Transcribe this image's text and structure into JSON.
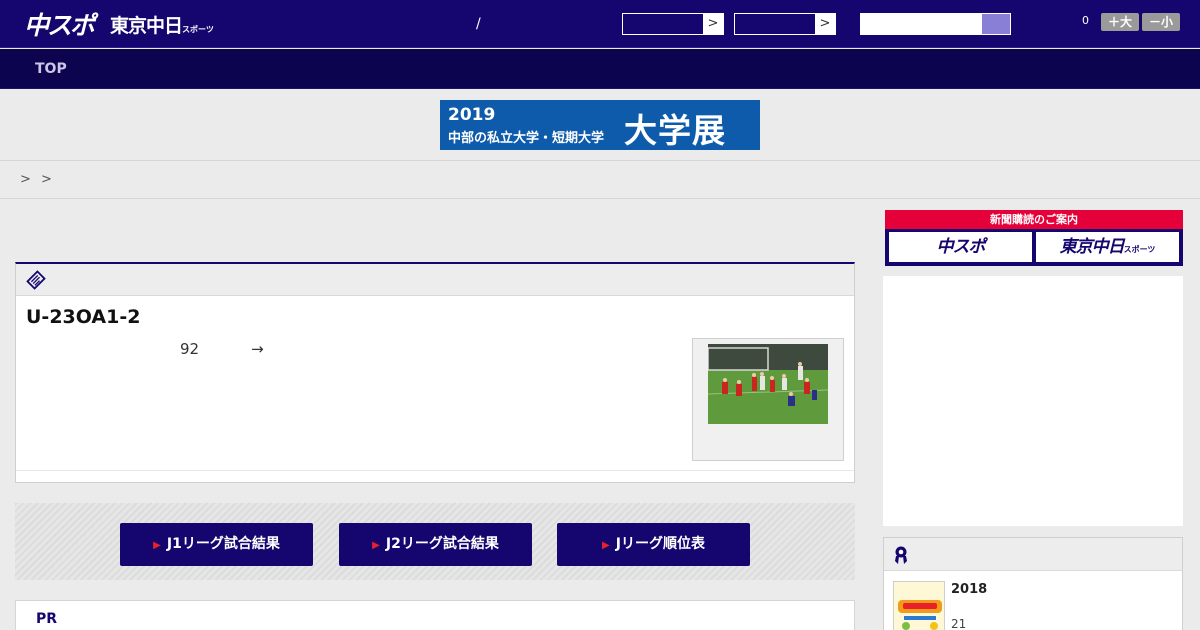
{
  "header": {
    "logo_main": "中スポ",
    "logo_sub": "東京中日",
    "logo_sub_small": "スポーツ",
    "separator": "/",
    "select1_arrow": ">",
    "select2_arrow": ">",
    "font_size_value": "0",
    "font_larger": "＋大",
    "font_smaller": "－小"
  },
  "nav": {
    "top": "TOP"
  },
  "banner": {
    "year": "2019",
    "desc": "中部の私立大学・短期大学",
    "big": "大学展"
  },
  "breadcrumb": "> >",
  "article": {
    "title": "U-23OA1-2",
    "meta_minutes": "92",
    "meta_arrow": "→"
  },
  "buttons": [
    "J1リーグ試合結果",
    "J2リーグ試合結果",
    "Jリーグ順位表"
  ],
  "pr": {
    "label": "PR"
  },
  "subscription": {
    "head": "新聞購読のご案内",
    "btn1": "中スポ",
    "btn2": "東京中日",
    "btn2_small": "スポーツ"
  },
  "ranking": {
    "title": "2018",
    "sub": "21"
  },
  "colors": {
    "navy": "#14056f",
    "red": "#e60039",
    "banner_blue": "#0e5bab"
  },
  "icons": [
    "newspaper-icon",
    "ribbon-icon",
    "search-icon"
  ]
}
